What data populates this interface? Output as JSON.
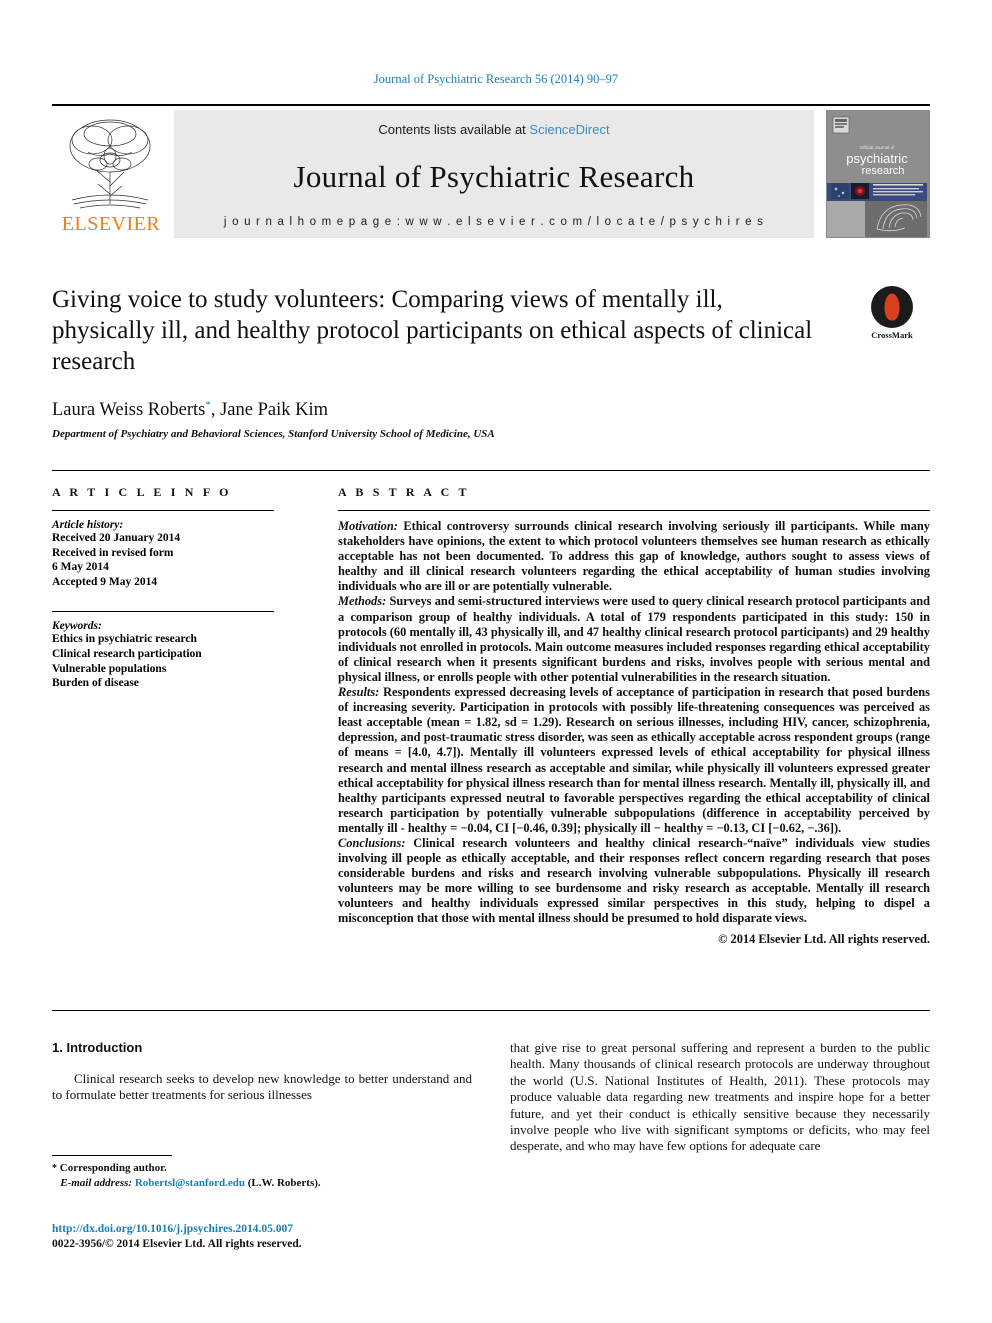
{
  "running_head": "Journal of Psychiatric Research 56 (2014) 90–97",
  "masthead": {
    "contents_prefix": "Contents lists available at ",
    "sciencedirect": "ScienceDirect",
    "journal_name": "Journal of Psychiatric Research",
    "homepage": "j o u r n a l   h o m e p a g e :   w w w . e l s e v i e r . c o m / l o c a t e / p s y c h i r e s",
    "publisher": "ELSEVIER",
    "cover_title_small": "Official Journal of",
    "cover_title_a": "psychiatric",
    "cover_title_b": "research",
    "accent_blue": "#3b8dbd",
    "link_blue": "#1a7db6",
    "elsevier_orange": "#f07f13"
  },
  "article": {
    "title": "Giving voice to study volunteers: Comparing views of mentally ill, physically ill, and healthy protocol participants on ethical aspects of clinical research",
    "authors": "Laura Weiss Roberts",
    "authors_second": ", Jane Paik Kim",
    "affiliation": "Department of Psychiatry and Behavioral Sciences, Stanford University School of Medicine, USA",
    "crossmark_label": "CrossMark"
  },
  "info": {
    "heading": "A R T I C L E   I N F O",
    "history_label": "Article history:",
    "history": [
      "Received 20 January 2014",
      "Received in revised form",
      "6 May 2014",
      "Accepted 9 May 2014"
    ],
    "keywords_label": "Keywords:",
    "keywords": [
      "Ethics in psychiatric research",
      "Clinical research participation",
      "Vulnerable populations",
      "Burden of disease"
    ]
  },
  "abstract": {
    "heading": "A B S T R A C T",
    "motivation_label": "Motivation:",
    "motivation": " Ethical controversy surrounds clinical research involving seriously ill participants. While many stakeholders have opinions, the extent to which protocol volunteers themselves see human research as ethically acceptable has not been documented. To address this gap of knowledge, authors sought to assess views of healthy and ill clinical research volunteers regarding the ethical acceptability of human studies involving individuals who are ill or are potentially vulnerable.",
    "methods_label": "Methods:",
    "methods": " Surveys and semi-structured interviews were used to query clinical research protocol participants and a comparison group of healthy individuals. A total of 179 respondents participated in this study: 150 in protocols (60 mentally ill, 43 physically ill, and 47 healthy clinical research protocol participants) and 29 healthy individuals not enrolled in protocols. Main outcome measures included responses regarding ethical acceptability of clinical research when it presents significant burdens and risks, involves people with serious mental and physical illness, or enrolls people with other potential vulnerabilities in the research situation.",
    "results_label": "Results:",
    "results": " Respondents expressed decreasing levels of acceptance of participation in research that posed burdens of increasing severity. Participation in protocols with possibly life-threatening consequences was perceived as least acceptable (mean = 1.82, sd = 1.29). Research on serious illnesses, including HIV, cancer, schizophrenia, depression, and post-traumatic stress disorder, was seen as ethically acceptable across respondent groups (range of means = [4.0, 4.7]). Mentally ill volunteers expressed levels of ethical acceptability for physical illness research and mental illness research as acceptable and similar, while physically ill volunteers expressed greater ethical acceptability for physical illness research than for mental illness research. Mentally ill, physically ill, and healthy participants expressed neutral to favorable perspectives regarding the ethical acceptability of clinical research participation by potentially vulnerable subpopulations (difference in acceptability perceived by mentally ill - healthy = −0.04, CI [−0.46, 0.39]; physically ill − healthy = −0.13, CI [−0.62, −.36]).",
    "conclusions_label": "Conclusions:",
    "conclusions": " Clinical research volunteers and healthy clinical research-“naïve” individuals view studies involving ill people as ethically acceptable, and their responses reflect concern regarding research that poses considerable burdens and risks and research involving vulnerable subpopulations. Physically ill research volunteers may be more willing to see burdensome and risky research as acceptable. Mentally ill research volunteers and healthy individuals expressed similar perspectives in this study, helping to dispel a misconception that those with mental illness should be presumed to hold disparate views.",
    "copyright": "© 2014 Elsevier Ltd. All rights reserved."
  },
  "body": {
    "section_heading": "1.  Introduction",
    "left_para": "Clinical research seeks to develop new knowledge to better understand and to formulate better treatments for serious illnesses",
    "right_para_1": "that give rise to great personal suffering and represent a burden to the public health. Many thousands of clinical research protocols are underway throughout the world (",
    "right_citation": "U.S. National Institutes of Health, 2011",
    "right_para_2": "). These protocols may produce valuable data regarding new treatments and inspire hope for a better future, and yet their conduct is ethically sensitive because they necessarily involve people who live with significant symptoms or deficits, who may feel desperate, and who may have few options for adequate care"
  },
  "footer": {
    "corresponding_star": "*",
    "corresponding": " Corresponding author.",
    "email_label": "E-mail address:",
    "email": "Robertsl@stanford.edu",
    "email_suffix": " (L.W. Roberts).",
    "doi": "http://dx.doi.org/10.1016/j.jpsychires.2014.05.007",
    "issn": "0022-3956/© 2014 Elsevier Ltd. All rights reserved."
  }
}
